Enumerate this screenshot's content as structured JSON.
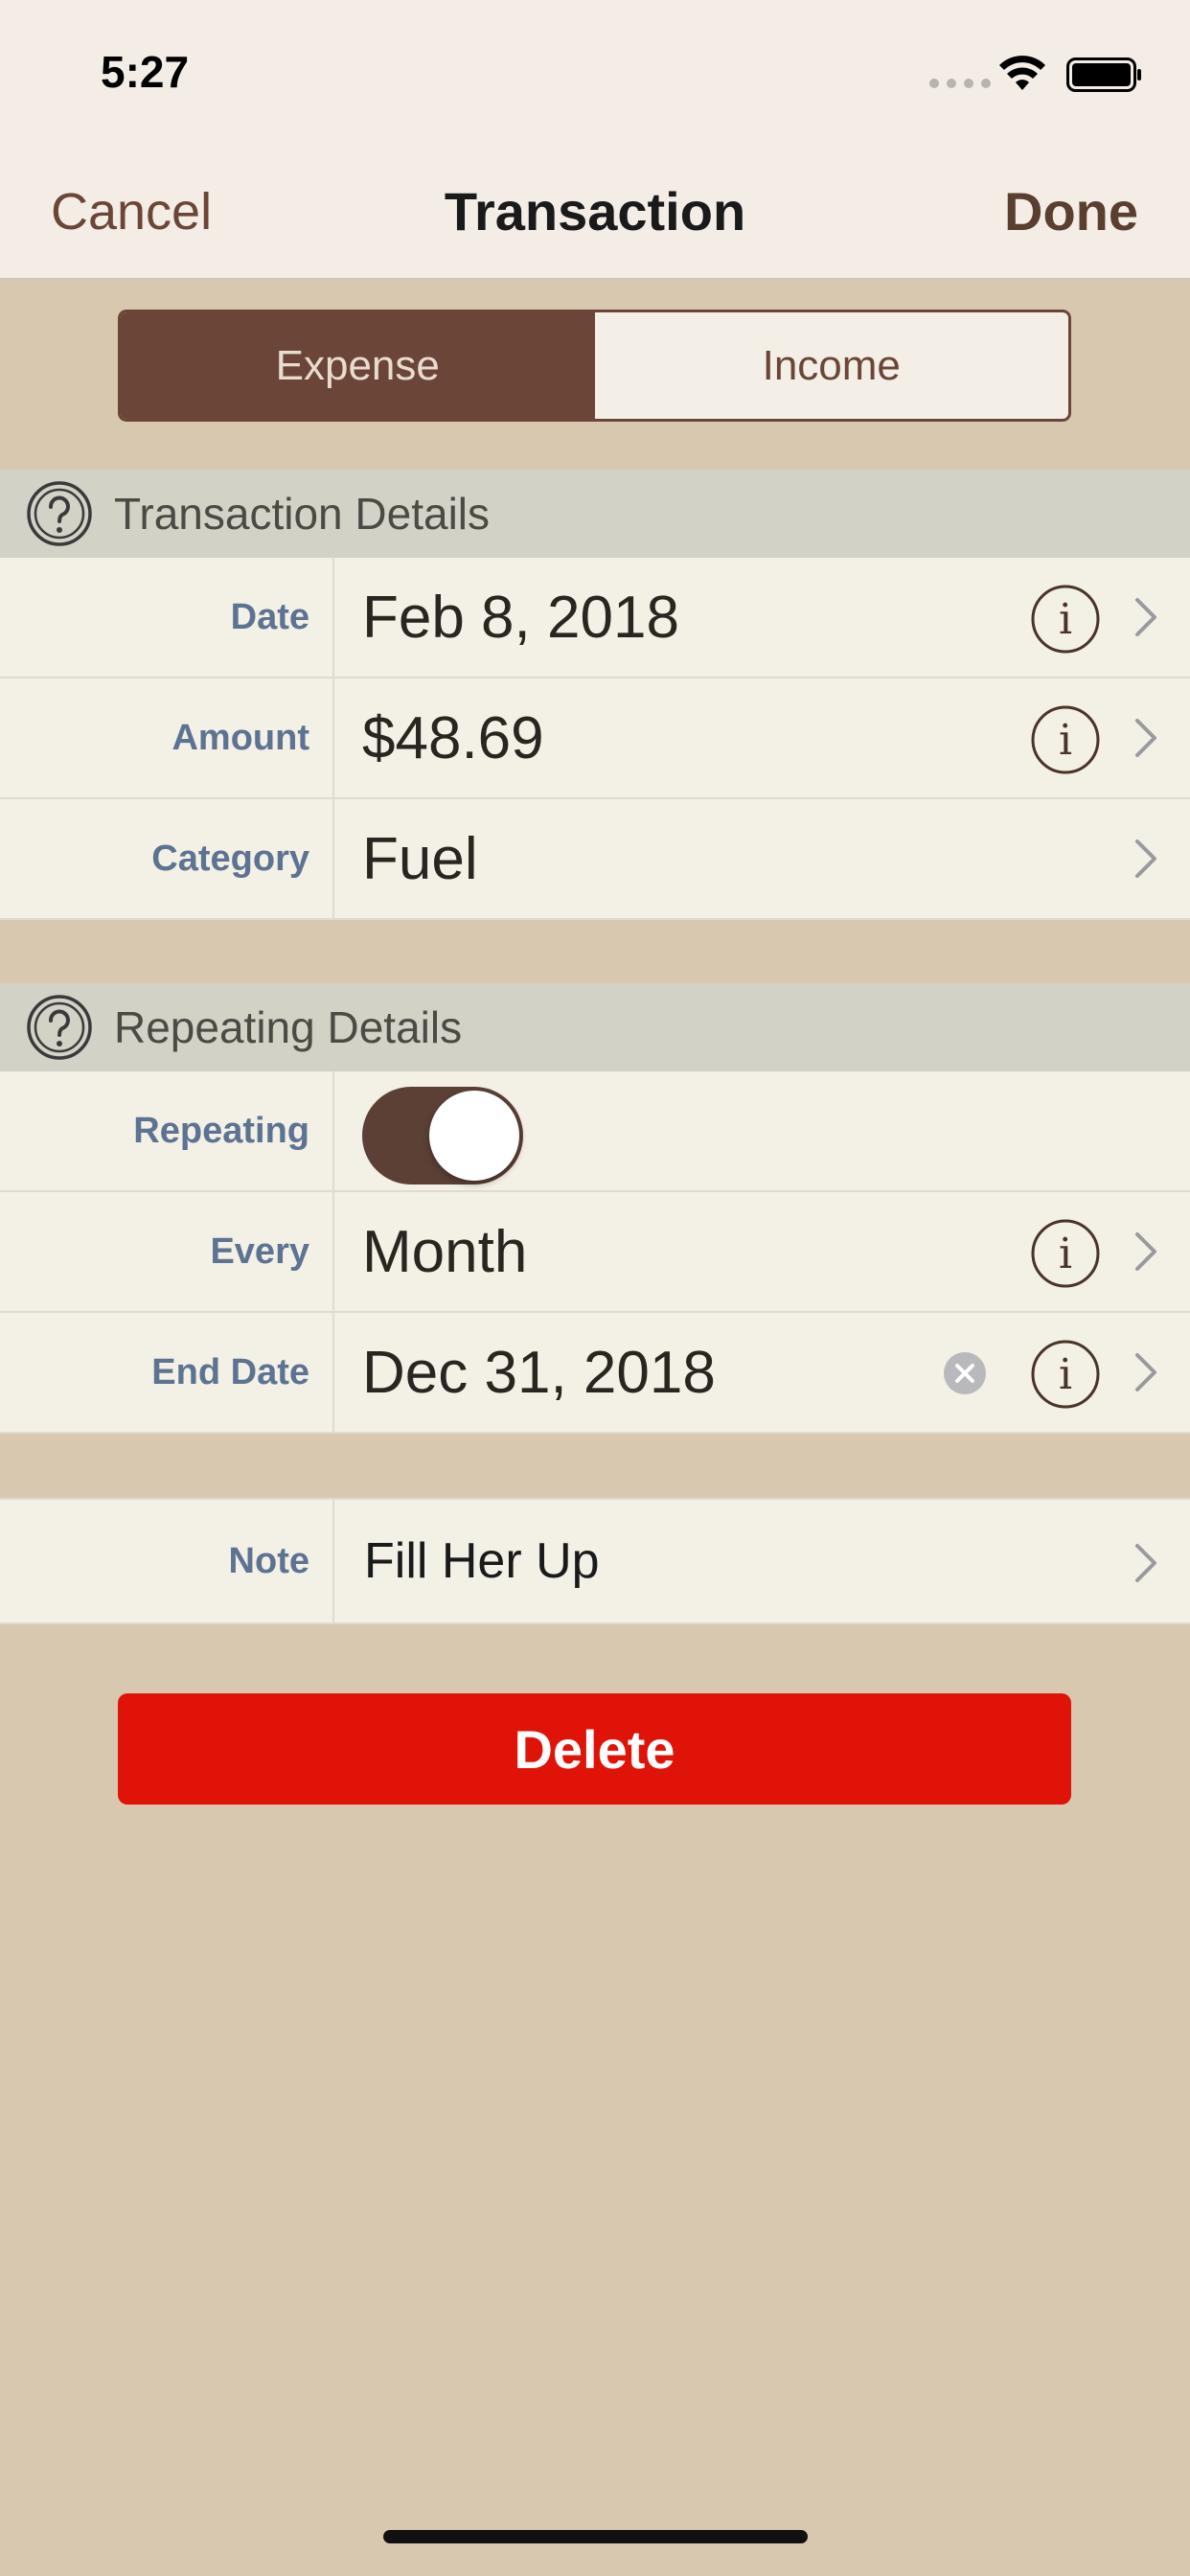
{
  "status_bar": {
    "time": "5:27"
  },
  "nav": {
    "cancel_label": "Cancel",
    "title": "Transaction",
    "done_label": "Done"
  },
  "type_selector": {
    "options": [
      "Expense",
      "Income"
    ],
    "selected": "Expense"
  },
  "transaction_details": {
    "title": "Transaction Details",
    "rows": [
      {
        "label": "Date",
        "value": "Feb 8, 2018"
      },
      {
        "label": "Amount",
        "value": "$48.69"
      },
      {
        "label": "Category",
        "value": "Fuel"
      }
    ]
  },
  "repeating_details": {
    "title": "Repeating Details",
    "repeating_label": "Repeating",
    "repeating_on": true,
    "every_label": "Every",
    "every_value": "Month",
    "end_date_label": "End Date",
    "end_date_value": "Dec 31, 2018"
  },
  "note": {
    "label": "Note",
    "value": "Fill Her Up"
  },
  "delete_label": "Delete",
  "colors": {
    "accent_brown": "#6b4638",
    "label_blue": "#5c7391",
    "delete_red": "#df1308",
    "background": "#d8c8b0"
  }
}
